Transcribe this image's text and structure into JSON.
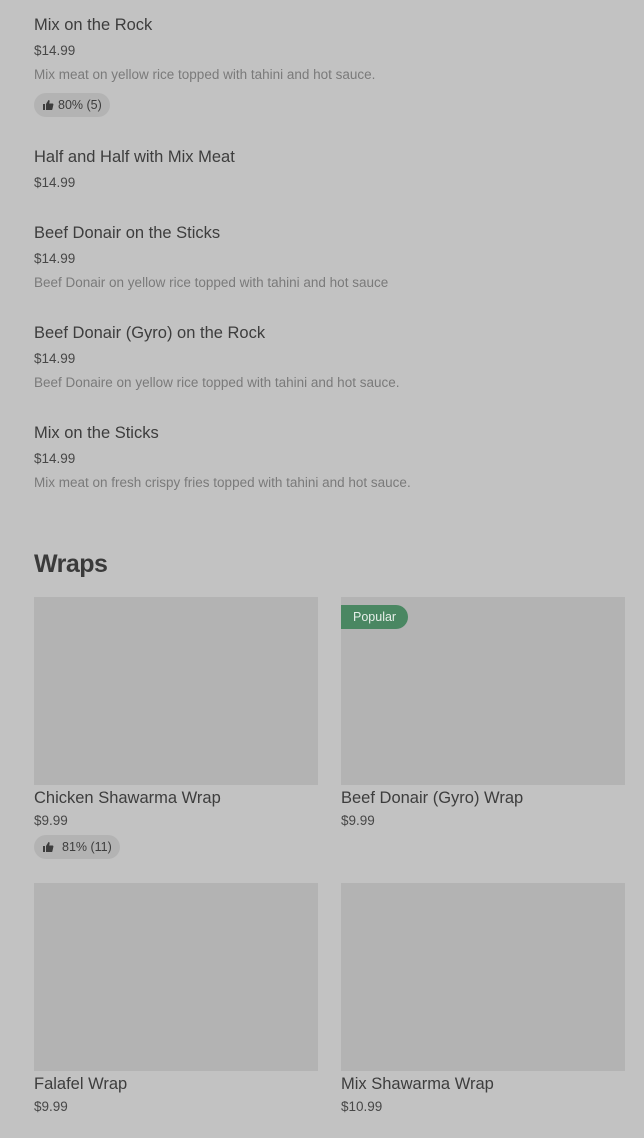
{
  "menu_items": [
    {
      "name": "Mix on the Rock",
      "price": "$14.99",
      "description": "Mix meat on yellow rice topped with tahini and hot sauce.",
      "rating": "80% (5)"
    },
    {
      "name": "Half and Half with Mix Meat",
      "price": "$14.99"
    },
    {
      "name": "Beef Donair on the Sticks",
      "price": "$14.99",
      "description": "Beef Donair on yellow rice topped with tahini and hot sauce"
    },
    {
      "name": "Beef Donair (Gyro) on the Rock",
      "price": "$14.99",
      "description": "Beef Donaire on yellow rice topped with tahini and hot sauce."
    },
    {
      "name": "Mix on the Sticks",
      "price": "$14.99",
      "description": "Mix meat on fresh crispy fries topped with tahini and hot sauce."
    }
  ],
  "wraps": {
    "title": "Wraps",
    "cards": [
      {
        "name": "Chicken Shawarma Wrap",
        "price": "$9.99",
        "rating": "81% (11)"
      },
      {
        "name": "Beef Donair (Gyro) Wrap",
        "price": "$9.99",
        "badge": "Popular"
      },
      {
        "name": "Falafel Wrap",
        "price": "$9.99"
      },
      {
        "name": "Mix Shawarma Wrap",
        "price": "$10.99"
      }
    ]
  },
  "icons": {
    "rating": "thumbs-up-icon"
  },
  "colors": {
    "background": "#c2c2c2",
    "image_placeholder": "#b3b3b3",
    "popular_badge": "#4a8762"
  }
}
